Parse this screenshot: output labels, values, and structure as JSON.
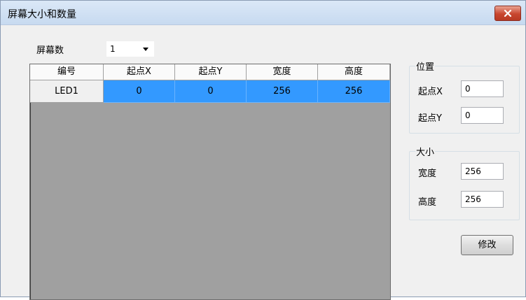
{
  "window": {
    "title": "屏幕大小和数量"
  },
  "screens": {
    "label": "屏幕数",
    "selected": "1"
  },
  "table": {
    "columns": [
      "编号",
      "起点X",
      "起点Y",
      "宽度",
      "高度"
    ],
    "rows": [
      {
        "id": "LED1",
        "x": "0",
        "y": "0",
        "w": "256",
        "h": "256"
      }
    ]
  },
  "position": {
    "title": "位置",
    "x_label": "起点X",
    "x_value": "0",
    "y_label": "起点Y",
    "y_value": "0"
  },
  "size": {
    "title": "大小",
    "w_label": "宽度",
    "w_value": "256",
    "h_label": "高度",
    "h_value": "256"
  },
  "buttons": {
    "modify": "修改"
  },
  "colors": {
    "selection": "#3399ff",
    "grid_bg": "#a0a0a0",
    "close": "#c8462f"
  }
}
